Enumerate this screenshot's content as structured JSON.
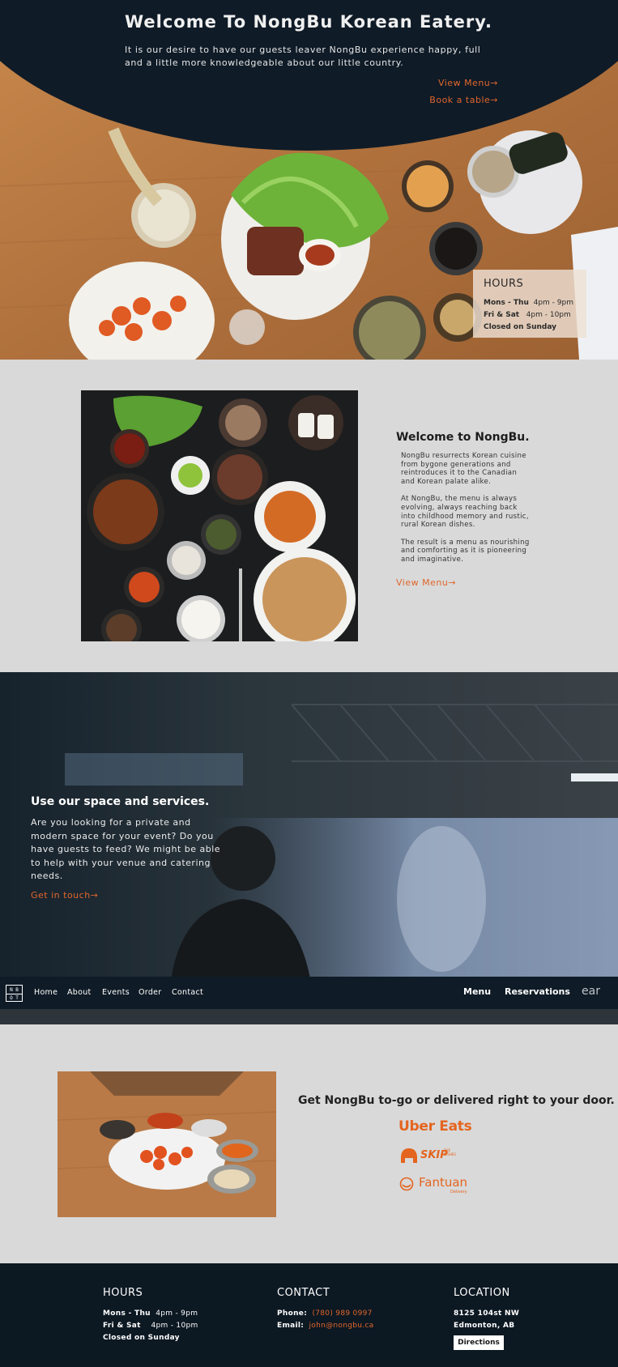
{
  "hero": {
    "title": "Welcome To NongBu Korean Eatery.",
    "text": "It is our desire to have our guests leaver NongBu experience happy, full and a little more knowledgeable about our little country.",
    "menu_link": "View Menu",
    "book_link": "Book a table",
    "arrow": "→"
  },
  "hours_card": {
    "heading": "HOURS",
    "row1_days": "Mons - Thu",
    "row1_time": "4pm - 9pm",
    "row2_days": "Fri & Sat",
    "row2_time": "4pm - 10pm",
    "row3": "Closed on Sunday"
  },
  "welcome": {
    "title": "Welcome to NongBu.",
    "p1": "NongBu resurrects Korean cuisine from bygone generations and reintroduces it to the Canadian and Korean palate alike.",
    "p2": "At NongBu, the menu is always evolving, always reaching back into childhood memory and rustic, rural Korean dishes.",
    "p3": "The result is a menu as nourishing and comforting as it is pioneering and imaginative.",
    "menu_link": "View Menu"
  },
  "space": {
    "title": "Use our space and services.",
    "body": "Are you looking for a private and modern space for your event? Do you have guests to feed? We might be able to help with your venue and catering needs.",
    "link": "Get in touch"
  },
  "nav": {
    "logo_top": "N B",
    "logo_bottom": "O T",
    "items": [
      "Home",
      "About",
      "Events",
      "Order",
      "Contact"
    ],
    "menu": "Menu",
    "reservations": "Reservations",
    "search_fragment": "ear"
  },
  "delivery": {
    "title": "Get NongBu to-go or delivered right to your door.",
    "uber": "Uber Eats",
    "skip": "SKIP",
    "skip_small": "THE DISHES",
    "fantuan": "Fantuan",
    "fantuan_small": "Delivery"
  },
  "footer": {
    "hours_heading": "HOURS",
    "hours_row1_days": "Mons - Thu",
    "hours_row1_time": "4pm - 9pm",
    "hours_row2_days": "Fri & Sat",
    "hours_row2_time": "4pm - 10pm",
    "hours_row3": "Closed on Sunday",
    "contact_heading": "CONTACT",
    "phone_label": "Phone:",
    "phone": "(780) 989 0997",
    "email_label": "Email:",
    "email": "john@nongbu.ca",
    "location_heading": "LOCATION",
    "address1": "8125 104st NW",
    "address2": "Edmonton, AB",
    "directions": "Directions"
  },
  "colors": {
    "accent": "#e0662c",
    "navy": "#0f1b27",
    "page_bg": "#d9d9d9"
  }
}
